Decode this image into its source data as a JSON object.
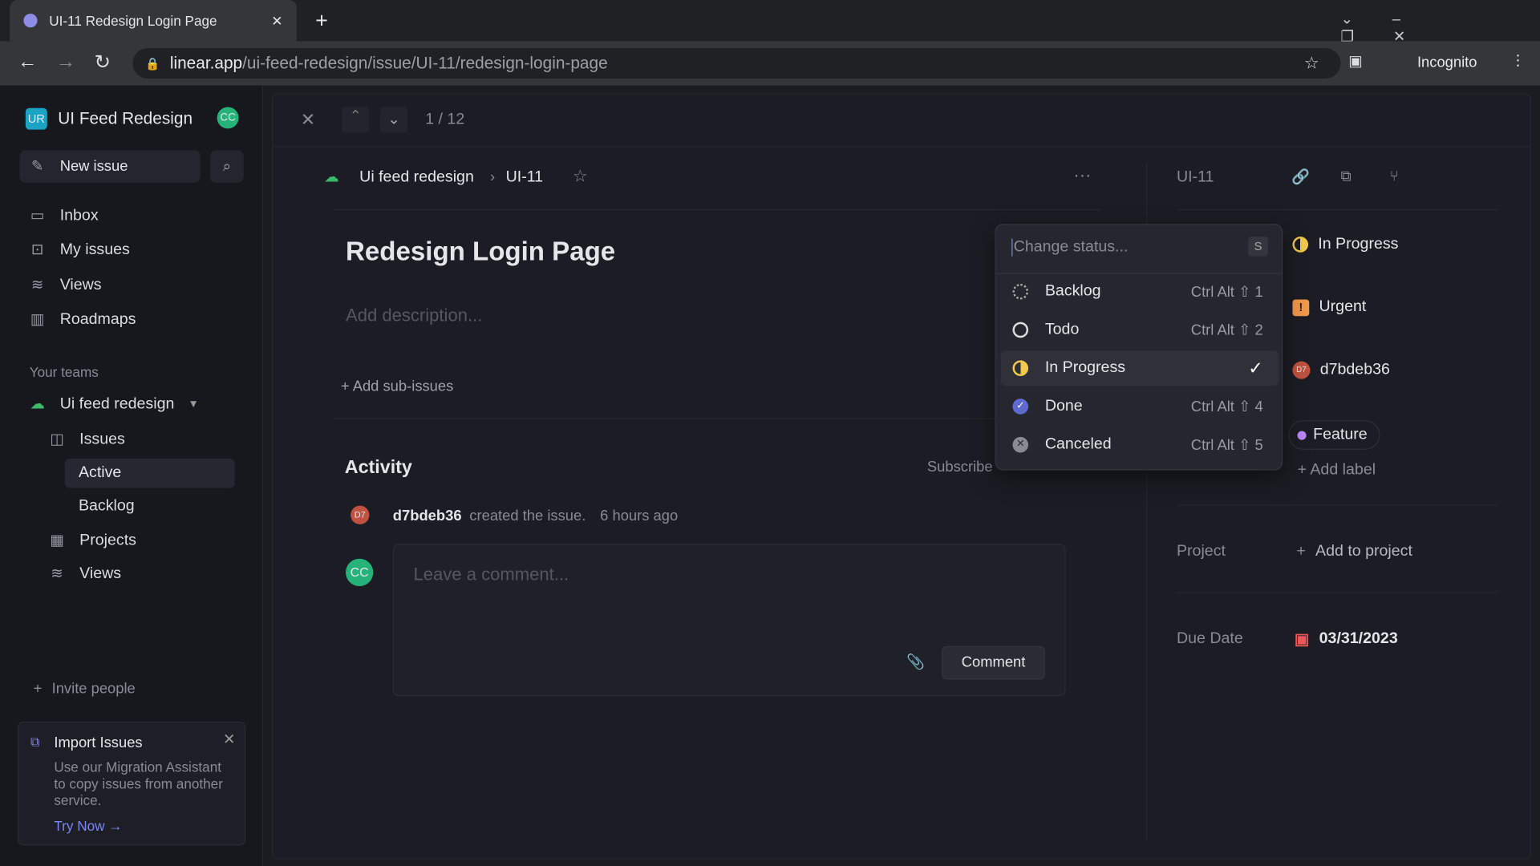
{
  "browser": {
    "tab_title": "UI-11 Redesign Login Page",
    "url_host": "linear.app",
    "url_path": "/ui-feed-redesign/issue/UI-11/redesign-login-page",
    "profile": "Incognito"
  },
  "sidebar": {
    "workspace_initials": "UR",
    "workspace": "UI Feed Redesign",
    "user_initials": "CC",
    "new_issue": "New issue",
    "items": [
      {
        "label": "Inbox"
      },
      {
        "label": "My issues"
      },
      {
        "label": "Views"
      },
      {
        "label": "Roadmaps"
      }
    ],
    "teams_heading": "Your teams",
    "team": "Ui feed redesign",
    "team_items": [
      {
        "label": "Issues"
      },
      {
        "label": "Active"
      },
      {
        "label": "Backlog"
      },
      {
        "label": "Projects"
      },
      {
        "label": "Views"
      }
    ],
    "invite": "Invite people",
    "import": {
      "title": "Import Issues",
      "body": "Use our Migration Assistant to copy issues from another service.",
      "cta": "Try Now →"
    }
  },
  "issue": {
    "pager": "1 / 12",
    "breadcrumb_team": "Ui feed redesign",
    "breadcrumb_id": "UI-11",
    "title": "Redesign Login Page",
    "description_placeholder": "Add description...",
    "add_sub": "+ Add sub-issues",
    "activity_heading": "Activity",
    "subscribe": "Subscribe",
    "event_user": "d7bdeb36",
    "event_avatar": "D7",
    "event_text": "created the issue.",
    "event_time": "6 hours ago",
    "comment_avatar": "CC",
    "comment_placeholder": "Leave a comment...",
    "comment_button": "Comment"
  },
  "status_menu": {
    "placeholder": "Change status...",
    "shortcut": "S",
    "options": [
      {
        "label": "Backlog",
        "shortcut": "Ctrl Alt ⇧ 1"
      },
      {
        "label": "Todo",
        "shortcut": "Ctrl Alt ⇧ 2"
      },
      {
        "label": "In Progress",
        "shortcut": "✓",
        "selected": true
      },
      {
        "label": "Done",
        "shortcut": "Ctrl Alt ⇧ 4"
      },
      {
        "label": "Canceled",
        "shortcut": "Ctrl Alt ⇧ 5"
      }
    ]
  },
  "props": {
    "id": "UI-11",
    "status": "In Progress",
    "priority": "Urgent",
    "assignee": "d7bdeb36",
    "assignee_avatar": "D7",
    "label": "Feature",
    "add_label": "+ Add label",
    "project_label": "Project",
    "project_value": "Add to project",
    "due_label": "Due Date",
    "due_value": "03/31/2023"
  },
  "colors": {
    "in_progress": "#f2c94c",
    "urgent": "#f2994a",
    "done": "#5e6ad2",
    "feature": "#bb87fc",
    "due": "#eb5757",
    "avatar_cc": "#26b37a"
  }
}
